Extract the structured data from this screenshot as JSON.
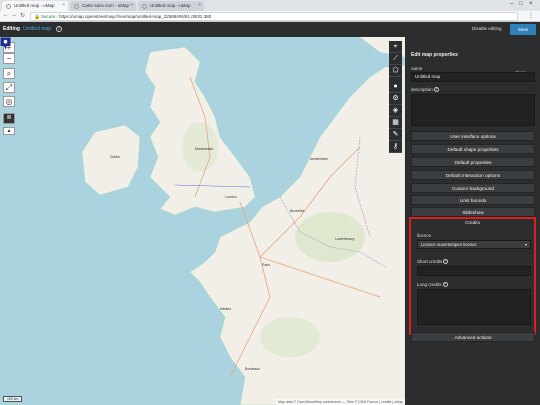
{
  "browser": {
    "tabs": [
      {
        "label": "Untitled map - uMap",
        "active": true
      },
      {
        "label": "Carte sans nom - uMap",
        "active": false
      },
      {
        "label": "Untitled map - uMap",
        "active": false
      }
    ],
    "url_secure_label": "Secure",
    "url": "https://umap.openstreetmap.fr/en/map/untitled-map_225884#6/51.000/2.380"
  },
  "topbar": {
    "editing_label": "Editing",
    "map_name": "Untitled map",
    "help_symbol": "?",
    "disable_editing_label": "Disable editing",
    "save_label": "Save"
  },
  "map": {
    "zoom_in": "+",
    "zoom_out": "−",
    "cities": [
      {
        "name": "London"
      },
      {
        "name": "Paris"
      },
      {
        "name": "Bruxelles"
      },
      {
        "name": "Amsterdam"
      },
      {
        "name": "Luxembourg"
      },
      {
        "name": "Manchester"
      },
      {
        "name": "Dublin"
      },
      {
        "name": "Nantes"
      },
      {
        "name": "Bordeaux"
      }
    ],
    "scale_label": "100 km",
    "attribution": "Map data © OpenStreetMap contributors — Tiles © OSM France | Leaflet | uMap"
  },
  "panel": {
    "title": "Edit map properties",
    "close_label": "Close",
    "name_label": "name",
    "name_value": "Untitled map",
    "description_label": "description",
    "sections": [
      "User interface options",
      "Default shape properties",
      "Default properties",
      "Default interaction options",
      "Custom background",
      "Limit bounds",
      "Slideshow"
    ],
    "credits": {
      "title": "Credits",
      "license_label": "licence",
      "license_value": "Licence ouverte/open licence",
      "short_credits_label": "Short credits",
      "long_credits_label": "Long credits"
    },
    "advanced_actions": "Advanced actions"
  },
  "colors": {
    "sea": "#aad3df",
    "land": "#f2efe9",
    "panel_bg": "#2b2d2f",
    "highlight": "#e01e1e",
    "marker": "#1e2c8c"
  }
}
